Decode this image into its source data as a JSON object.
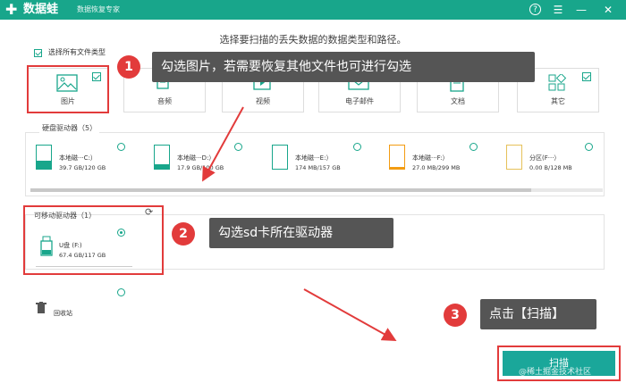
{
  "titlebar": {
    "app_name": "数据蛙",
    "app_sub": "数据恢复专家",
    "btn_help": "?",
    "btn_menu": "☰",
    "btn_min": "—",
    "btn_close": "✕"
  },
  "heading": "选择要扫描的丢失数据的数据类型和路径。",
  "select_all": "选择所有文件类型",
  "file_types": [
    {
      "label": "图片",
      "icon": "image-icon"
    },
    {
      "label": "音频",
      "icon": "audio-icon"
    },
    {
      "label": "视频",
      "icon": "video-icon"
    },
    {
      "label": "电子邮件",
      "icon": "email-icon"
    },
    {
      "label": "文档",
      "icon": "document-icon"
    },
    {
      "label": "其它",
      "icon": "other-icon"
    }
  ],
  "callouts": {
    "c1_num": "1",
    "c1_text": "勾选图片，若需要恢复其他文件也可进行勾选",
    "c2_num": "2",
    "c2_text": "勾选sd卡所在驱动器",
    "c3_num": "3",
    "c3_text": "点击【扫描】"
  },
  "hard_drives": {
    "title": "硬盘驱动器（5）",
    "drives": [
      {
        "name": "本地磁···C:）",
        "size": "39.7 GB/120 GB",
        "fill_pct": 33,
        "fill_color": "#18a68b"
      },
      {
        "name": "本地磁···D:）",
        "size": "17.9 GB/100 GB",
        "fill_pct": 18,
        "fill_color": "#18a68b"
      },
      {
        "name": "本地磁···E:）",
        "size": "174 MB/157 GB",
        "fill_pct": 0,
        "fill_color": "#18a68b"
      },
      {
        "name": "本地磁···F:）",
        "size": "27.0 MB/299 MB",
        "fill_pct": 9,
        "fill_color": "#f39c12"
      },
      {
        "name": "分区(F···）",
        "size": "0.00  B/128 MB",
        "fill_pct": 0,
        "fill_color": "#e6c15a"
      }
    ]
  },
  "removable": {
    "title": "可移动驱动器（1）",
    "drive_name": "U盘 (F:)",
    "drive_size": "67.4 GB/117 GB",
    "fill_pct": 58
  },
  "recycle": {
    "label": "回收站"
  },
  "scan_button": "扫描",
  "watermark": "@稀土掘金技术社区"
}
